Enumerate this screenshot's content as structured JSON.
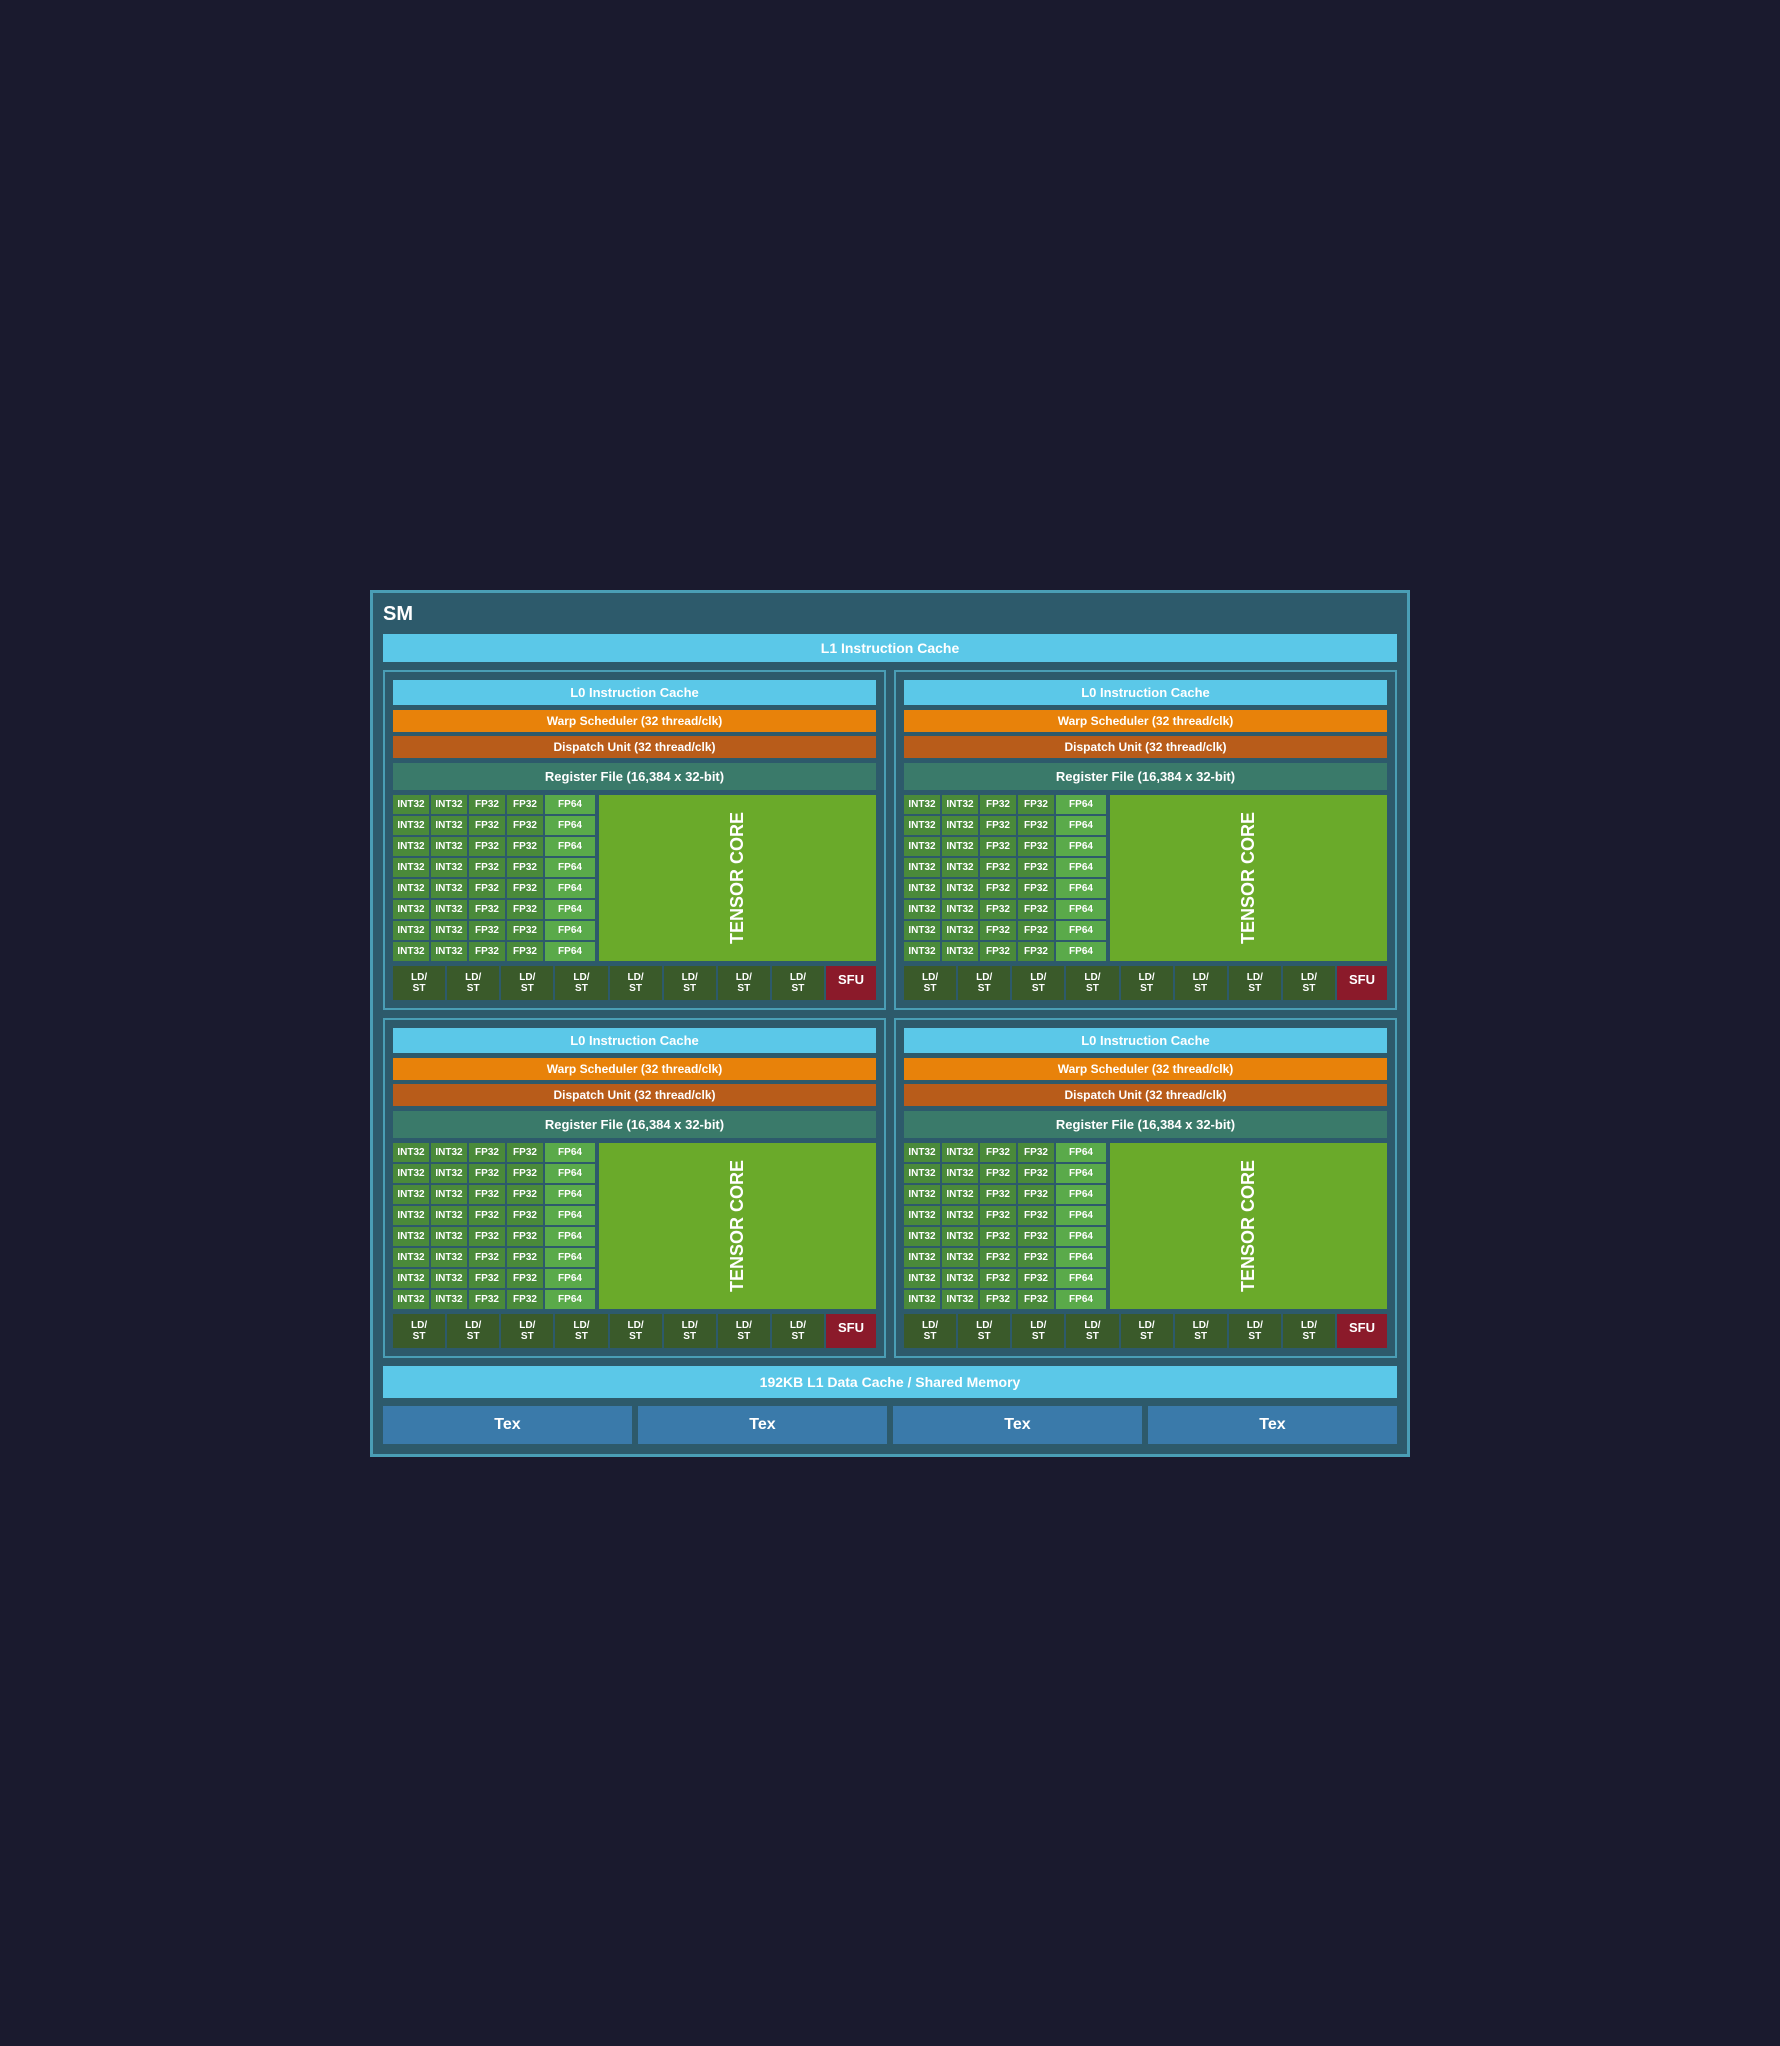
{
  "sm": {
    "title": "SM",
    "l1_instruction_cache": "L1 Instruction Cache",
    "l1_data_cache": "192KB L1 Data Cache / Shared Memory",
    "units": [
      {
        "l0_cache": "L0 Instruction Cache",
        "warp_scheduler": "Warp Scheduler (32 thread/clk)",
        "dispatch_unit": "Dispatch Unit (32 thread/clk)",
        "register_file": "Register File (16,384 x 32-bit)",
        "tensor_core": "TENSOR CORE",
        "sfu": "SFU"
      },
      {
        "l0_cache": "L0 Instruction Cache",
        "warp_scheduler": "Warp Scheduler (32 thread/clk)",
        "dispatch_unit": "Dispatch Unit (32 thread/clk)",
        "register_file": "Register File (16,384 x 32-bit)",
        "tensor_core": "TENSOR CORE",
        "sfu": "SFU"
      },
      {
        "l0_cache": "L0 Instruction Cache",
        "warp_scheduler": "Warp Scheduler (32 thread/clk)",
        "dispatch_unit": "Dispatch Unit (32 thread/clk)",
        "register_file": "Register File (16,384 x 32-bit)",
        "tensor_core": "TENSOR CORE",
        "sfu": "SFU"
      },
      {
        "l0_cache": "L0 Instruction Cache",
        "warp_scheduler": "Warp Scheduler (32 thread/clk)",
        "dispatch_unit": "Dispatch Unit (32 thread/clk)",
        "register_file": "Register File (16,384 x 32-bit)",
        "tensor_core": "TENSOR CORE",
        "sfu": "SFU"
      }
    ],
    "tex_units": [
      "Tex",
      "Tex",
      "Tex",
      "Tex"
    ],
    "ldst_label": "LD/\nST"
  }
}
